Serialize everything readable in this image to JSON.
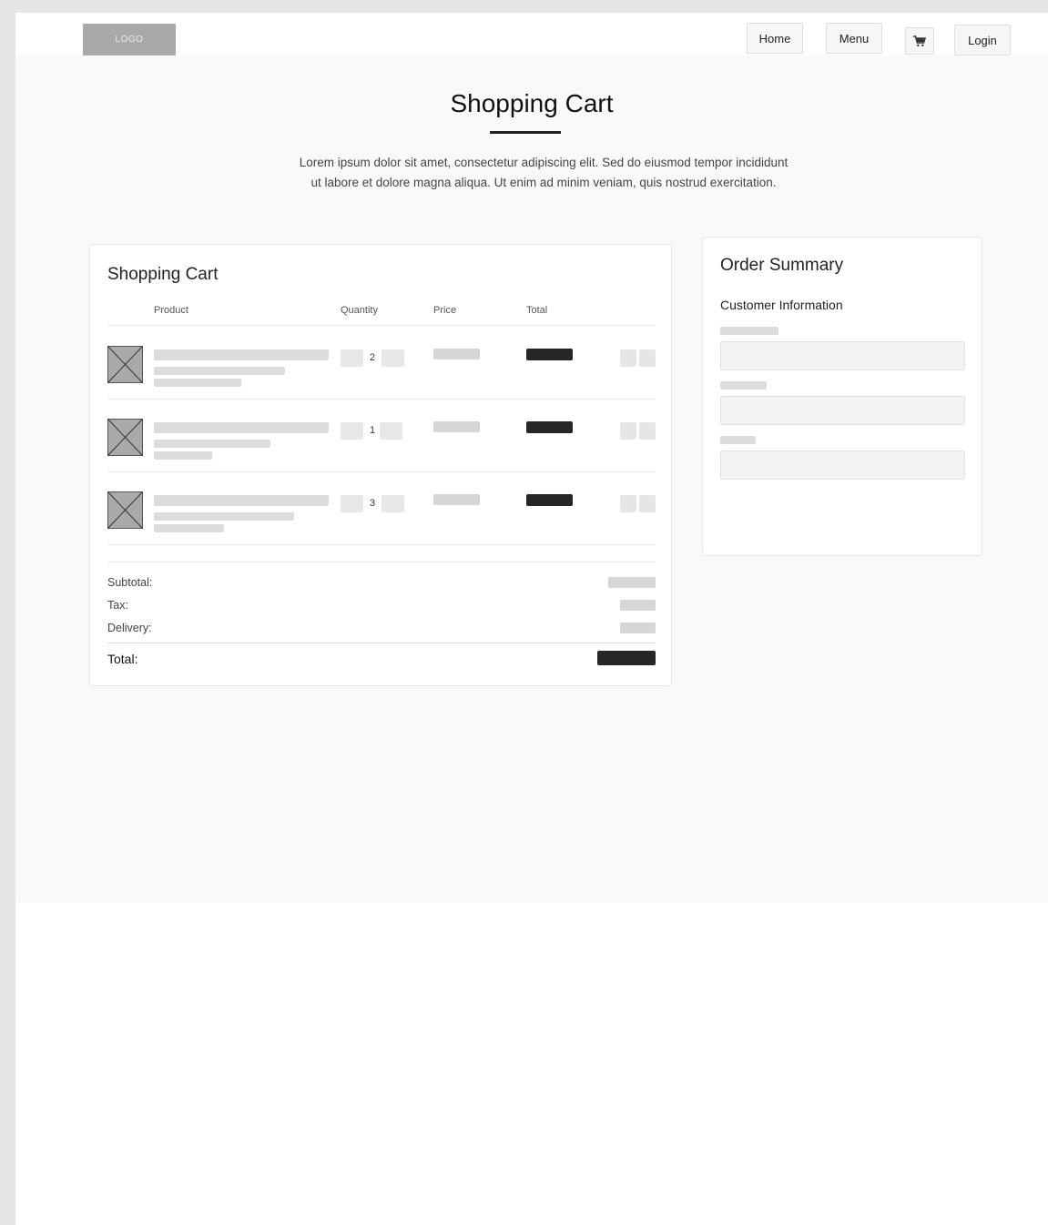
{
  "header": {
    "logo_text": "LOGO",
    "nav": {
      "home": "Home",
      "menu": "Menu",
      "login": "Login"
    },
    "cart_icon": "cart-icon"
  },
  "hero": {
    "title": "Shopping Cart",
    "description": "Lorem ipsum dolor sit amet, consectetur adipiscing elit. Sed do eiusmod tempor incididunt ut labore et dolore magna aliqua. Ut enim ad minim veniam, quis nostrud exercitation."
  },
  "cart": {
    "title": "Shopping Cart",
    "columns": {
      "product": "Product",
      "quantity": "Quantity",
      "price": "Price",
      "total": "Total"
    },
    "items": [
      {
        "quantity": "2"
      },
      {
        "quantity": "1"
      },
      {
        "quantity": "3"
      }
    ],
    "summary": {
      "subtotal_label": "Subtotal:",
      "tax_label": "Tax:",
      "delivery_label": "Delivery:",
      "total_label": "Total:"
    }
  },
  "order_summary": {
    "title": "Order Summary",
    "section_title": "Customer Information"
  },
  "colors": {
    "accent": "#262626",
    "placeholder": "#dcdcdc",
    "page_background": "#f9f9f9"
  }
}
